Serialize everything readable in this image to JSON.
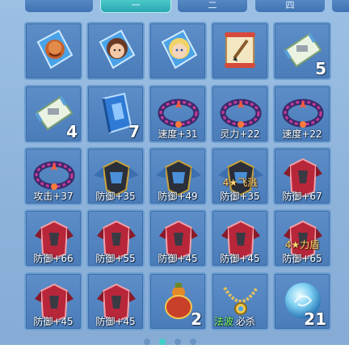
{
  "tabs": [
    {
      "label": ""
    },
    {
      "label": "一"
    },
    {
      "label": "二"
    },
    {
      "label": "四"
    }
  ],
  "colors": {
    "panel_bg": "#8fb3d9",
    "slot_bg": "#4a7cb9",
    "slot_border": "#6e9fd2",
    "tab_active": "#2aa7b2",
    "tab_inactive": "#3f73b2",
    "stat_text": "#ffffff",
    "tag_text": "#ffd67a",
    "skill_green": "#7cff5a"
  },
  "items": [
    {
      "icon": "red-beast-card-icon",
      "count": "",
      "stat": ""
    },
    {
      "icon": "girl-portrait-card-icon",
      "count": "",
      "stat": ""
    },
    {
      "icon": "blonde-girl-card-icon",
      "count": "",
      "stat": ""
    },
    {
      "icon": "scroll-brush-icon",
      "count": "",
      "stat": ""
    },
    {
      "icon": "map-scroll-icon",
      "count": "5",
      "stat": ""
    },
    {
      "icon": "map-scroll-icon",
      "count": "4",
      "stat": ""
    },
    {
      "icon": "blue-book-icon",
      "count": "7",
      "stat": ""
    },
    {
      "icon": "flame-ring-icon",
      "count": "",
      "stat": "速度+31"
    },
    {
      "icon": "flame-ring-icon",
      "count": "",
      "stat": "灵力+22"
    },
    {
      "icon": "flame-ring-icon",
      "count": "",
      "stat": "速度+22"
    },
    {
      "icon": "flame-ring-icon",
      "count": "",
      "stat": "攻击+37"
    },
    {
      "icon": "winged-armor-icon",
      "count": "",
      "stat": "防御+35"
    },
    {
      "icon": "winged-armor-icon",
      "count": "",
      "stat": "防御+49"
    },
    {
      "icon": "winged-armor-icon",
      "count": "",
      "stat": "防御+35",
      "tag": "4★飞溅"
    },
    {
      "icon": "red-armor-icon",
      "count": "",
      "stat": "防御+67"
    },
    {
      "icon": "red-armor-icon",
      "count": "",
      "stat": "防御+66"
    },
    {
      "icon": "red-armor-icon",
      "count": "",
      "stat": "防御+55"
    },
    {
      "icon": "red-armor-icon",
      "count": "",
      "stat": "防御+45"
    },
    {
      "icon": "red-armor-icon",
      "count": "",
      "stat": "防御+45"
    },
    {
      "icon": "red-armor-icon",
      "count": "",
      "stat": "防御+65",
      "tag": "4★力盾"
    },
    {
      "icon": "red-armor-icon",
      "count": "",
      "stat": "防御+45"
    },
    {
      "icon": "red-armor-icon",
      "count": "",
      "stat": "防御+45"
    },
    {
      "icon": "treasure-gourd-icon",
      "count": "2",
      "stat": ""
    },
    {
      "icon": "gold-necklace-icon",
      "count": "",
      "stat": "",
      "skills": [
        "法波",
        "必杀"
      ]
    },
    {
      "icon": "blue-orb-icon",
      "count": "21",
      "stat": ""
    }
  ],
  "pager": {
    "pages": 4,
    "current": 1
  }
}
